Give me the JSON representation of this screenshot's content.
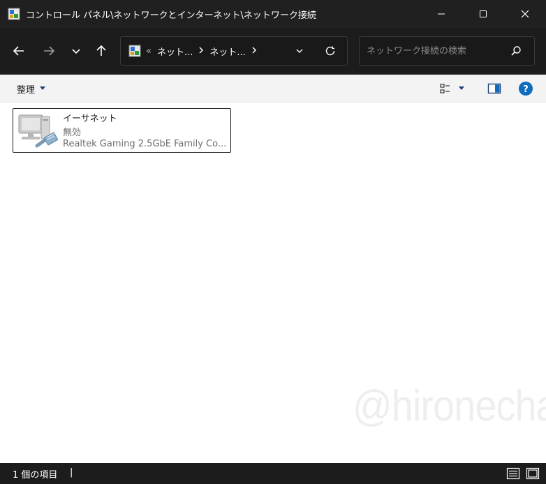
{
  "window": {
    "title": "コントロール パネル\\ネットワークとインターネット\\ネットワーク接続"
  },
  "nav": {
    "breadcrumb_prefix": "«",
    "crumbs": [
      "ネット...",
      "ネット..."
    ]
  },
  "search": {
    "placeholder": "ネットワーク接続の検索"
  },
  "toolbar": {
    "organize_label": "整理"
  },
  "items": [
    {
      "name": "イーサネット",
      "status": "無効",
      "device": "Realtek Gaming 2.5GbE Family Co..."
    }
  ],
  "statusbar": {
    "count_label": "1 個の項目",
    "separator": "|"
  },
  "watermark": "@hironechan",
  "colors": {
    "accent_blue": "#0f6cbd",
    "titlebar_bg": "#202020",
    "content_bg": "#ffffff"
  }
}
